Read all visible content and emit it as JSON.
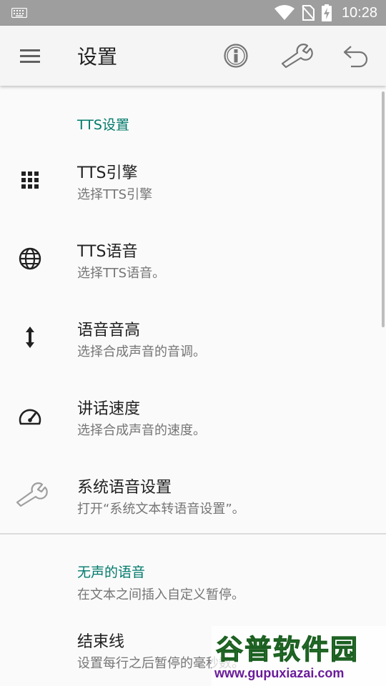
{
  "status_bar": {
    "time": "10:28",
    "icons": [
      "keyboard-icon",
      "wifi-icon",
      "no-sim-icon",
      "battery-charging-icon"
    ]
  },
  "app_bar": {
    "title": "设置",
    "actions": [
      "info-icon",
      "wrench-icon",
      "undo-icon"
    ]
  },
  "sections": [
    {
      "category": "TTS设置",
      "items": [
        {
          "icon": "grid-icon",
          "title": "TTS引擎",
          "summary": "选择TTS引擎"
        },
        {
          "icon": "globe-icon",
          "title": "TTS语音",
          "summary": "选择TTS语音。"
        },
        {
          "icon": "vertical-arrows-icon",
          "title": "语音音高",
          "summary": "选择合成声音的音调。"
        },
        {
          "icon": "speedometer-icon",
          "title": "讲话速度",
          "summary": "选择合成声音的速度。"
        },
        {
          "icon": "wrench-icon",
          "title": "系统语音设置",
          "summary": "打开“系统文本转语音设置”。"
        }
      ]
    },
    {
      "category": "无声的语音",
      "category_summary": "在文本之间插入自定义暂停。",
      "items": [
        {
          "title": "结束线",
          "summary": "设置每行之后暂停的毫秒数。"
        }
      ]
    }
  ],
  "watermark": {
    "name": "谷普软件园",
    "url": "www.gupuxiazai.com"
  },
  "colors": {
    "accent": "#00796b",
    "status_bar": "#9e9e9e",
    "app_bar": "#f5f5f5",
    "background": "#fafafa"
  }
}
